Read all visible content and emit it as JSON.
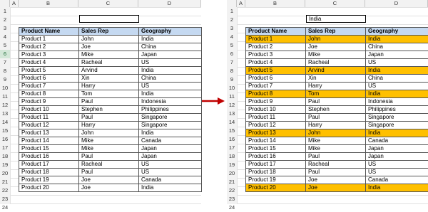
{
  "columns": [
    "A",
    "B",
    "C",
    "D"
  ],
  "row_numbers": [
    "1",
    "2",
    "3",
    "4",
    "5",
    "6",
    "7",
    "8",
    "9",
    "10",
    "11",
    "12",
    "13",
    "14",
    "15",
    "16",
    "17",
    "18",
    "19",
    "20",
    "21",
    "22",
    "23",
    "24"
  ],
  "left": {
    "filter_value": ""
  },
  "right": {
    "filter_value": "India"
  },
  "table": {
    "headers": [
      "Product Name",
      "Sales Rep",
      "Geography"
    ],
    "rows": [
      [
        "Product 1",
        "John",
        "India"
      ],
      [
        "Product 2",
        "Joe",
        "China"
      ],
      [
        "Product 3",
        "Mike",
        "Japan"
      ],
      [
        "Product 4",
        "Racheal",
        "US"
      ],
      [
        "Product 5",
        "Arvind",
        "India"
      ],
      [
        "Product 6",
        "Xin",
        "China"
      ],
      [
        "Product 7",
        "Harry",
        "US"
      ],
      [
        "Product 8",
        "Tom",
        "India"
      ],
      [
        "Product 9",
        "Paul",
        "Indonesia"
      ],
      [
        "Product 10",
        "Stephen",
        "Philippines"
      ],
      [
        "Product 11",
        "Paul",
        "Singapore"
      ],
      [
        "Product 12",
        "Harry",
        "Singapore"
      ],
      [
        "Product 13",
        "John",
        "India"
      ],
      [
        "Product 14",
        "Mike",
        "Canada"
      ],
      [
        "Product 15",
        "Mike",
        "Japan"
      ],
      [
        "Product 16",
        "Paul",
        "Japan"
      ],
      [
        "Product 17",
        "Racheal",
        "US"
      ],
      [
        "Product 18",
        "Paul",
        "US"
      ],
      [
        "Product 19",
        "Joe",
        "Canada"
      ],
      [
        "Product 20",
        "Joe",
        "India"
      ]
    ]
  },
  "highlight_color": "#ffc000",
  "header_fill": "#c5d9f1",
  "arrow_color": "#c00000",
  "arrow_icon": "right-arrow-icon"
}
